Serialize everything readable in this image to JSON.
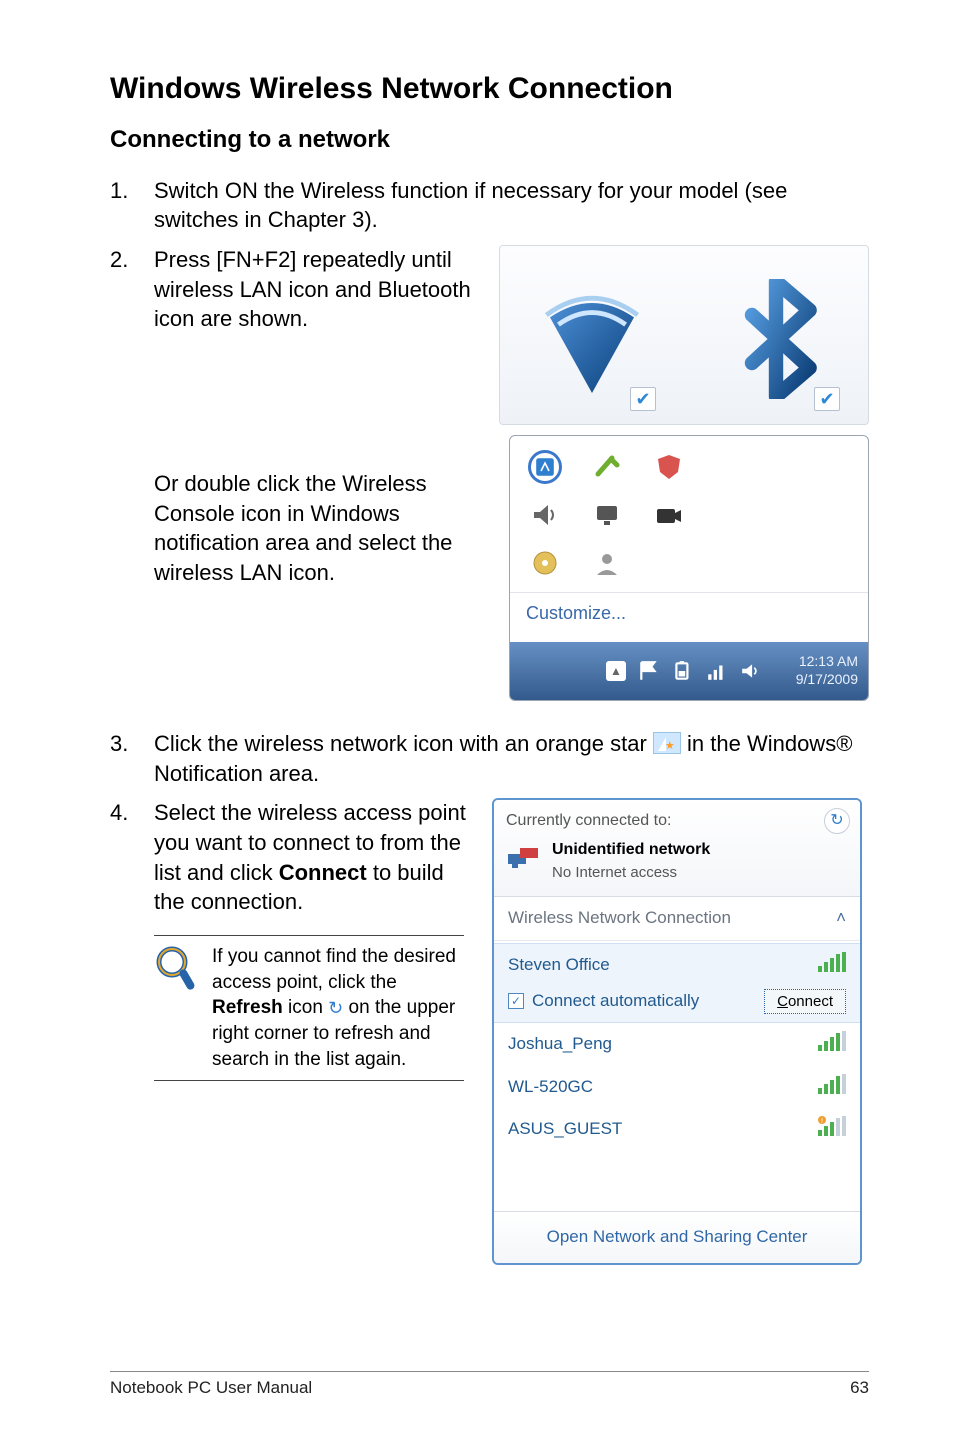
{
  "section_title": "Windows Wireless Network Connection",
  "subsection_title": "Connecting to a network",
  "steps": {
    "s1": {
      "num": "1.",
      "text": "Switch ON the Wireless function if necessary for your model (see switches in Chapter 3)."
    },
    "s2": {
      "num": "2.",
      "text": "Press [FN+F2] repeatedly until wireless LAN icon and Bluetooth icon are shown."
    },
    "s2b": "Or double click the Wireless Console icon in Windows notification area and select the wireless LAN icon.",
    "s3": {
      "num": "3.",
      "pre": "Click the wireless network icon with an orange star ",
      "post": " in the Windows® Notification area."
    },
    "s4": {
      "num": "4.",
      "text_a": "Select the wireless access point you want to connect to from the list and click ",
      "bold": "Connect",
      "text_b": " to build the connection."
    }
  },
  "note": {
    "pre": "If you cannot find the desired access point, click the ",
    "bold": "Refresh",
    "mid": " icon ",
    "post": " on the upper right corner to refresh and search in the list again."
  },
  "tray": {
    "customize": "Customize...",
    "time": "12:13 AM",
    "date": "9/17/2009"
  },
  "netflyout": {
    "currently": "Currently connected to:",
    "unet_title": "Unidentified network",
    "unet_sub": "No Internet access",
    "wnc_label": "Wireless Network Connection",
    "auto_label": "Connect automatically",
    "connect_btn": "Connect",
    "networks": [
      {
        "name": "Steven Office",
        "signal": 5,
        "warn": false
      },
      {
        "name": "Joshua_Peng",
        "signal": 4,
        "warn": false
      },
      {
        "name": "WL-520GC",
        "signal": 4,
        "warn": false
      },
      {
        "name": "ASUS_GUEST",
        "signal": 3,
        "warn": true
      }
    ],
    "footer_link": "Open Network and Sharing Center"
  },
  "footer": {
    "left": "Notebook PC User Manual",
    "right": "63"
  }
}
